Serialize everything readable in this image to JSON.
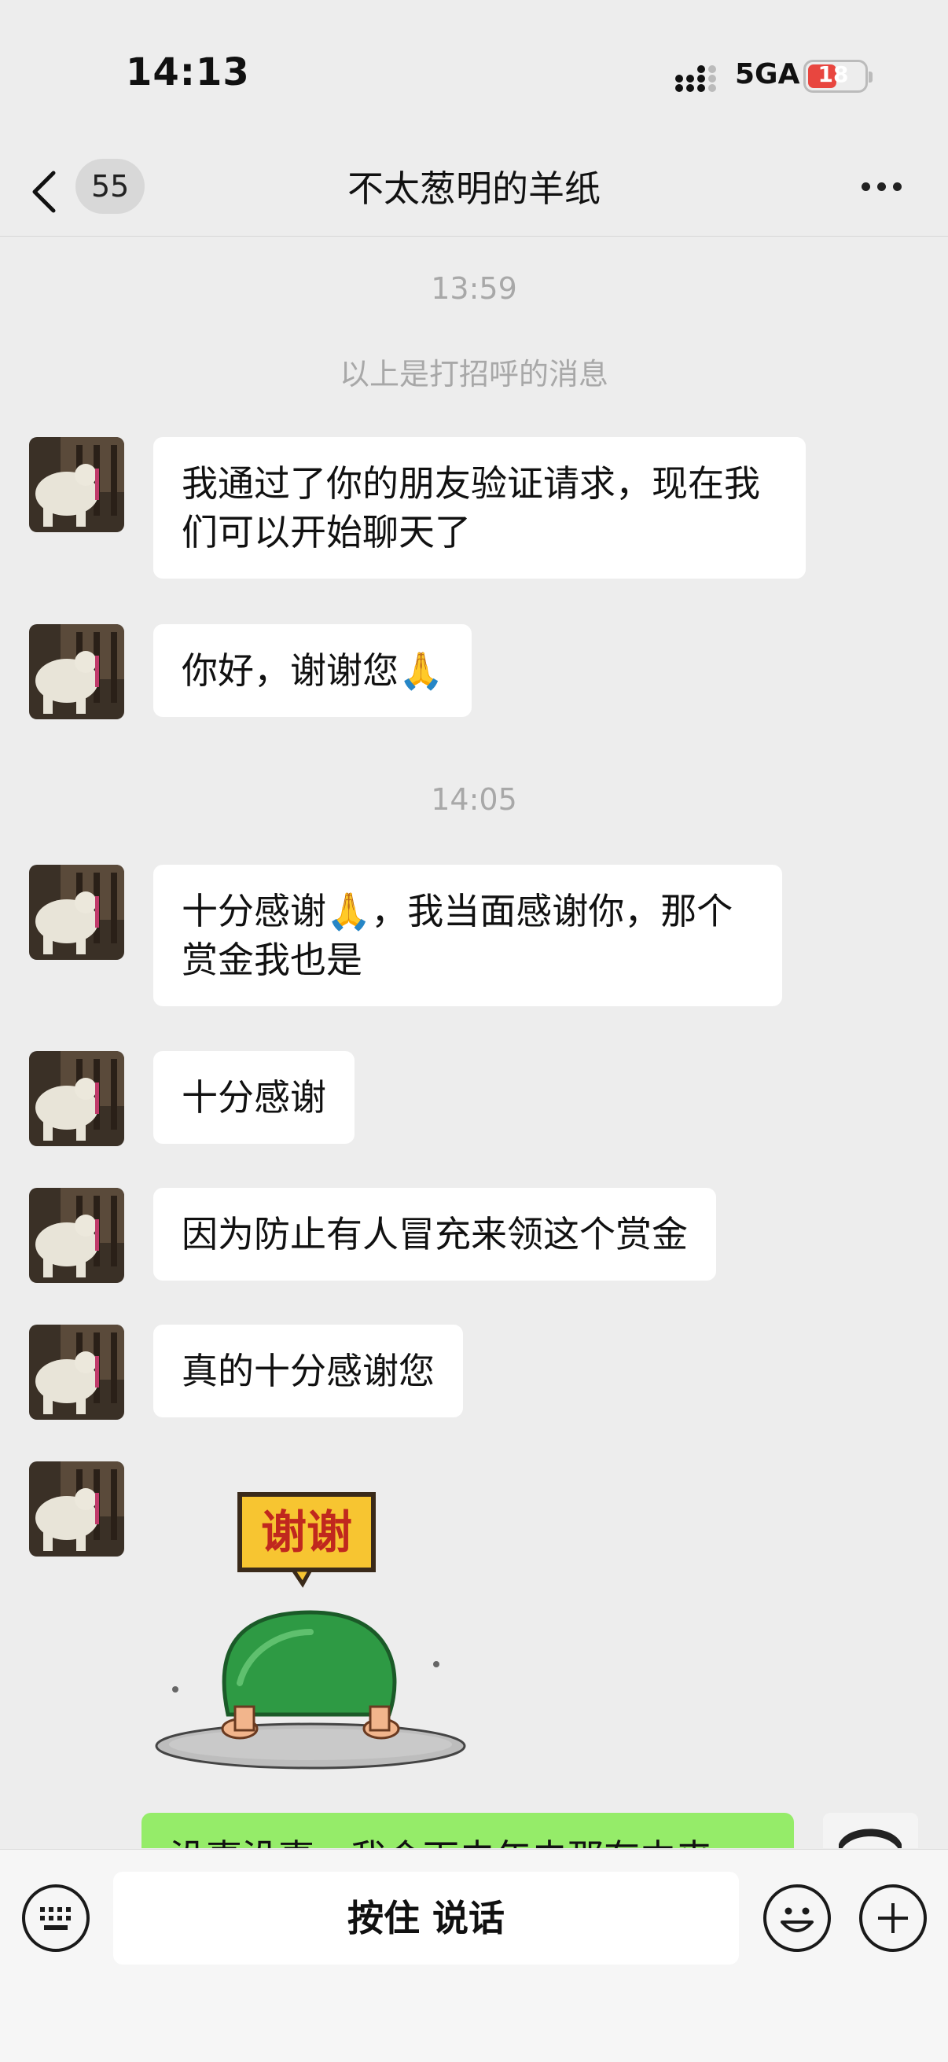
{
  "status_bar": {
    "time": "14:13",
    "network": "5GA",
    "battery": "18"
  },
  "nav": {
    "unread_count": "55",
    "title": "不太葱明的羊纸"
  },
  "chat": {
    "timestamps": [
      "13:59",
      "14:05"
    ],
    "system_message": "以上是打招呼的消息",
    "messages": [
      "我通过了你的朋友验证请求，现在我们可以开始聊天了",
      "你好，谢谢您🙏",
      "十分感谢🙏，我当面感谢你，那个赏金我也是",
      "十分感谢",
      "因为防止有人冒充来领这个赏金",
      "真的十分感谢您"
    ],
    "sticker_text": "谢谢",
    "outgoing_partial": "没事没事，我会下去年去那有中来"
  },
  "input_bar": {
    "talk_label": "按住 说话"
  },
  "colors": {
    "background": "#ededed",
    "bubble_in": "#ffffff",
    "bubble_out": "#95ec69",
    "battery_low": "#e8463f"
  },
  "icons": [
    "back-chevron-icon",
    "more-icon",
    "keyboard-icon",
    "emoji-icon",
    "plus-icon",
    "signal-icon",
    "battery-icon"
  ]
}
